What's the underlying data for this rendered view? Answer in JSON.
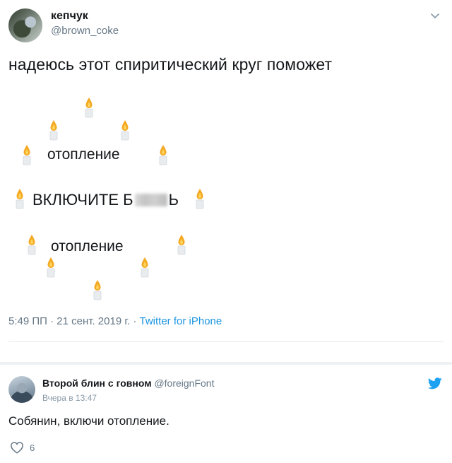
{
  "tweet": {
    "author_name": "кепчук",
    "author_handle": "@brown_coke",
    "text": "надеюсь этот спиритический круг поможет",
    "circle": {
      "top_word": "отопление",
      "middle_prefix": "ВКЛЮЧИТЕ Б",
      "middle_suffix": "Ь",
      "bottom_word": "отопление"
    },
    "time": "5:49 ПП",
    "date": "21 сент. 2019 г.",
    "sep": "·",
    "source": "Twitter for iPhone"
  },
  "reply": {
    "author_name": "Второй блин с говном",
    "author_handle": "@foreignFont",
    "time": "Вчера в 13:47",
    "text": "Собянин, включи отопление.",
    "likes": "6"
  },
  "colors": {
    "text": "#14171a",
    "muted": "#657786",
    "link": "#1b95e0",
    "twitter_blue": "#1da1f2",
    "candle_flame": "#f4a924",
    "candle_body": "#e8ecef"
  },
  "icons": {
    "chevron": "chevron-down-icon",
    "candle": "candle-icon",
    "bird": "twitter-bird-icon",
    "heart": "heart-icon"
  }
}
